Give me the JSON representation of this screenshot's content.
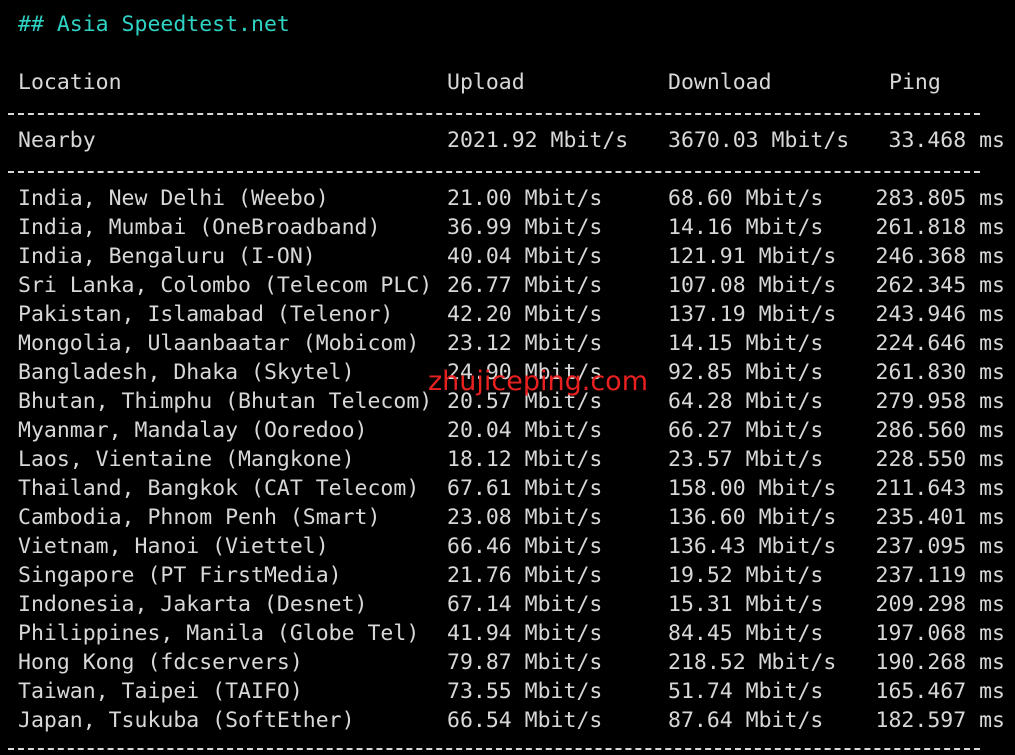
{
  "heading": "## Asia Speedtest.net",
  "columns": {
    "location": "Location",
    "upload": "Upload",
    "download": "Download",
    "ping": "Ping"
  },
  "nearby": {
    "location": "Nearby",
    "upload": "2021.92 Mbit/s",
    "download": "3670.03 Mbit/s",
    "ping": "33.468 ms"
  },
  "rows": [
    {
      "location": "India, New Delhi (Weebo)",
      "upload": "21.00 Mbit/s",
      "download": "68.60 Mbit/s",
      "ping": "283.805 ms"
    },
    {
      "location": "India, Mumbai (OneBroadband)",
      "upload": "36.99 Mbit/s",
      "download": "14.16 Mbit/s",
      "ping": "261.818 ms"
    },
    {
      "location": "India, Bengaluru (I-ON)",
      "upload": "40.04 Mbit/s",
      "download": "121.91 Mbit/s",
      "ping": "246.368 ms"
    },
    {
      "location": "Sri Lanka, Colombo (Telecom PLC)",
      "upload": "26.77 Mbit/s",
      "download": "107.08 Mbit/s",
      "ping": "262.345 ms"
    },
    {
      "location": "Pakistan, Islamabad (Telenor)",
      "upload": "42.20 Mbit/s",
      "download": "137.19 Mbit/s",
      "ping": "243.946 ms"
    },
    {
      "location": "Mongolia, Ulaanbaatar (Mobicom)",
      "upload": "23.12 Mbit/s",
      "download": "14.15 Mbit/s",
      "ping": "224.646 ms"
    },
    {
      "location": "Bangladesh, Dhaka (Skytel)",
      "upload": "24.90 Mbit/s",
      "download": "92.85 Mbit/s",
      "ping": "261.830 ms"
    },
    {
      "location": "Bhutan, Thimphu (Bhutan Telecom)",
      "upload": "20.57 Mbit/s",
      "download": "64.28 Mbit/s",
      "ping": "279.958 ms"
    },
    {
      "location": "Myanmar, Mandalay (Ooredoo)",
      "upload": "20.04 Mbit/s",
      "download": "66.27 Mbit/s",
      "ping": "286.560 ms"
    },
    {
      "location": "Laos, Vientaine (Mangkone)",
      "upload": "18.12 Mbit/s",
      "download": "23.57 Mbit/s",
      "ping": "228.550 ms"
    },
    {
      "location": "Thailand, Bangkok (CAT Telecom)",
      "upload": "67.61 Mbit/s",
      "download": "158.00 Mbit/s",
      "ping": "211.643 ms"
    },
    {
      "location": "Cambodia, Phnom Penh (Smart)",
      "upload": "23.08 Mbit/s",
      "download": "136.60 Mbit/s",
      "ping": "235.401 ms"
    },
    {
      "location": "Vietnam, Hanoi (Viettel)",
      "upload": "66.46 Mbit/s",
      "download": "136.43 Mbit/s",
      "ping": "237.095 ms"
    },
    {
      "location": "Singapore (PT FirstMedia)",
      "upload": "21.76 Mbit/s",
      "download": "19.52 Mbit/s",
      "ping": "237.119 ms"
    },
    {
      "location": "Indonesia, Jakarta (Desnet)",
      "upload": "67.14 Mbit/s",
      "download": "15.31 Mbit/s",
      "ping": "209.298 ms"
    },
    {
      "location": "Philippines, Manila (Globe Tel)",
      "upload": "41.94 Mbit/s",
      "download": "84.45 Mbit/s",
      "ping": "197.068 ms"
    },
    {
      "location": "Hong Kong (fdcservers)",
      "upload": "79.87 Mbit/s",
      "download": "218.52 Mbit/s",
      "ping": "190.268 ms"
    },
    {
      "location": "Taiwan, Taipei (TAIFO)",
      "upload": "73.55 Mbit/s",
      "download": "51.74 Mbit/s",
      "ping": "165.467 ms"
    },
    {
      "location": "Japan, Tsukuba (SoftEther)",
      "upload": "66.54 Mbit/s",
      "download": "87.64 Mbit/s",
      "ping": "182.597 ms"
    }
  ],
  "watermark": "zhujiceping.com",
  "colors": {
    "background": "#000000",
    "text": "#d8d8d8",
    "heading": "#2ed3c4",
    "watermark": "#e82020"
  }
}
